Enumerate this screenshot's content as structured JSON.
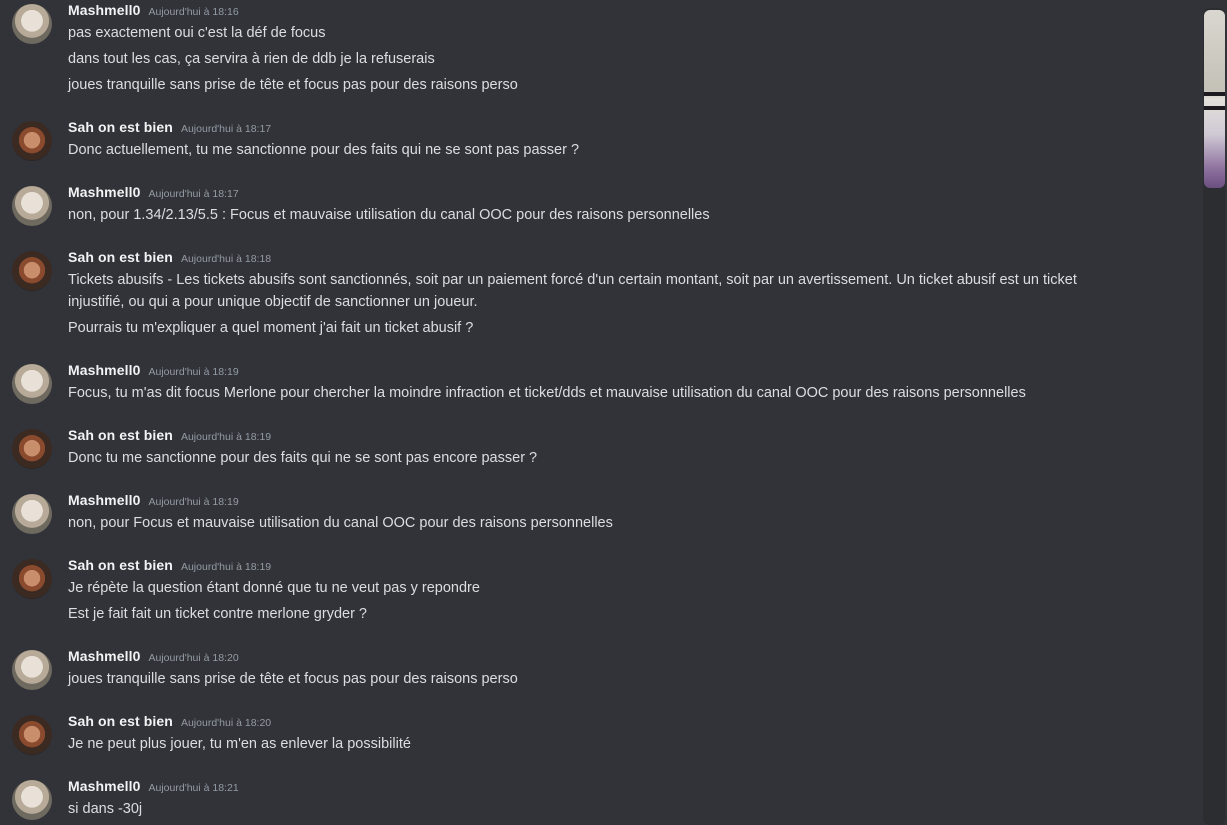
{
  "messages": [
    {
      "author": "Mashmell0",
      "time": "Aujourd'hui à 18:16",
      "lines": [
        "pas exactement oui c'est la déf de focus",
        "dans tout les cas, ça servira à rien de ddb je la refuserais",
        "joues tranquille sans prise de tête et focus pas pour des raisons perso"
      ]
    },
    {
      "author": "Sah on est bien",
      "time": "Aujourd'hui à 18:17",
      "lines": [
        "Donc actuellement, tu me sanctionne pour des faits qui ne se sont pas passer ?"
      ]
    },
    {
      "author": "Mashmell0",
      "time": "Aujourd'hui à 18:17",
      "lines": [
        "non, pour 1.34/2.13/5.5 : Focus et mauvaise utilisation du canal OOC pour des raisons personnelles"
      ]
    },
    {
      "author": "Sah on est bien",
      "time": "Aujourd'hui à 18:18",
      "lines": [
        "Tickets abusifs - Les tickets abusifs sont sanctionnés, soit par un paiement forcé d'un certain montant, soit par un avertissement. Un ticket abusif est un ticket",
        "injustifié, ou qui a pour unique objectif de sanctionner un joueur.",
        "Pourrais tu m'expliquer a quel moment j'ai fait un ticket abusif ?"
      ]
    },
    {
      "author": "Mashmell0",
      "time": "Aujourd'hui à 18:19",
      "lines": [
        "Focus, tu m'as dit focus Merlone pour chercher la moindre infraction et ticket/dds et mauvaise utilisation du canal OOC pour des raisons personnelles"
      ]
    },
    {
      "author": "Sah on est bien",
      "time": "Aujourd'hui à 18:19",
      "lines": [
        "Donc tu me sanctionne pour des faits qui ne se sont pas encore passer ?"
      ]
    },
    {
      "author": "Mashmell0",
      "time": "Aujourd'hui à 18:19",
      "lines": [
        "non, pour Focus et mauvaise utilisation du canal OOC pour des raisons personnelles"
      ]
    },
    {
      "author": "Sah on est bien",
      "time": "Aujourd'hui à 18:19",
      "lines": [
        "Je répète la question étant donné que tu ne veut pas y repondre",
        "Est je fait fait un ticket contre merlone gryder ?"
      ]
    },
    {
      "author": "Mashmell0",
      "time": "Aujourd'hui à 18:20",
      "lines": [
        "joues tranquille sans prise de tête et focus pas pour des raisons perso"
      ]
    },
    {
      "author": "Sah on est bien",
      "time": "Aujourd'hui à 18:20",
      "lines": [
        "Je ne peut plus jouer, tu m'en as enlever la possibilité"
      ]
    },
    {
      "author": "Mashmell0",
      "time": "Aujourd'hui à 18:21",
      "lines": [
        "si dans -30j"
      ]
    }
  ]
}
